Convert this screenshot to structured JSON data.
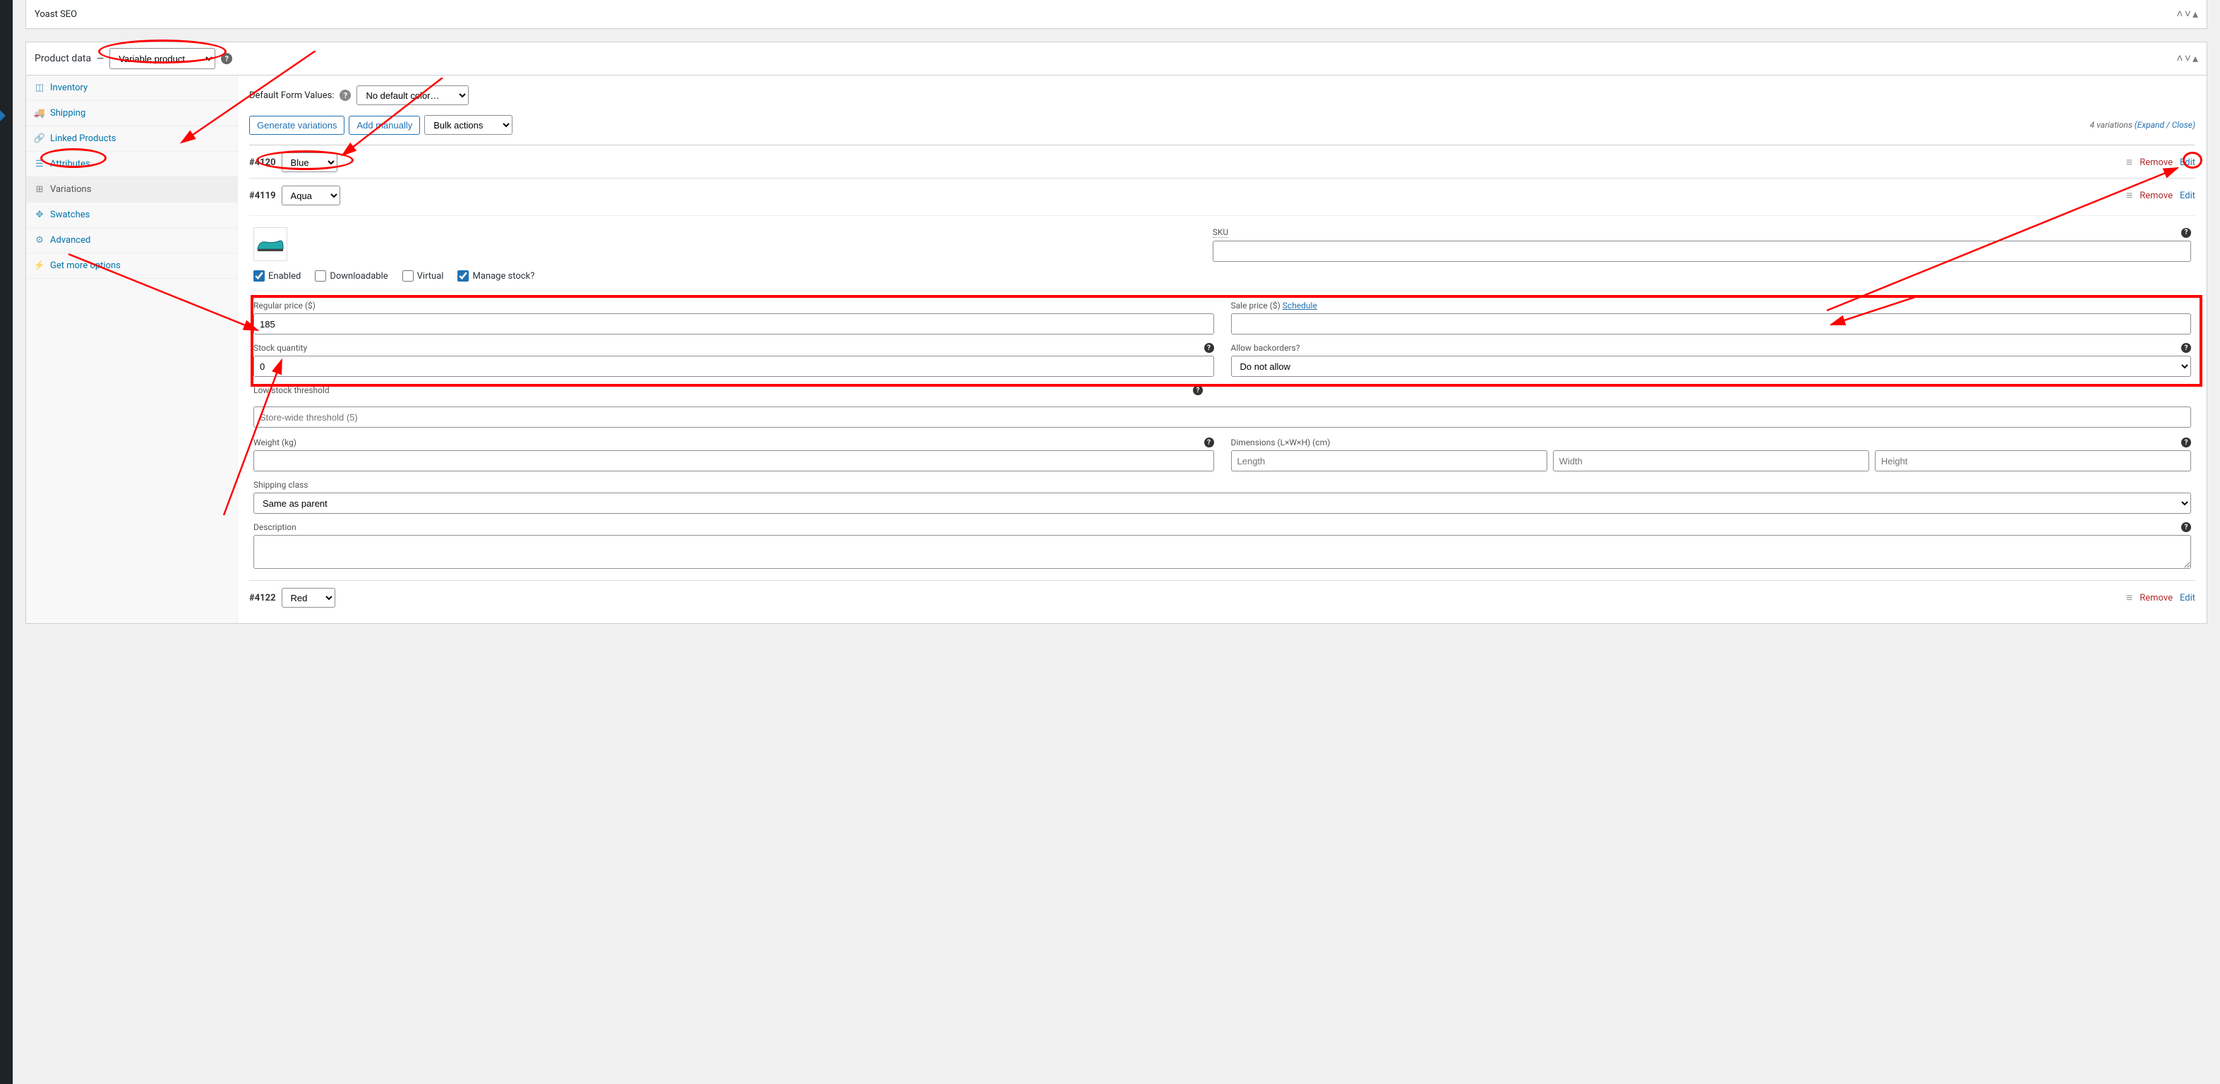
{
  "top_panel": {
    "title": "Yoast SEO"
  },
  "postbox": {
    "title": "Product data",
    "product_type": "Variable product"
  },
  "tabs": [
    {
      "key": "inventory",
      "label": "Inventory",
      "icon": "archive"
    },
    {
      "key": "shipping",
      "label": "Shipping",
      "icon": "truck"
    },
    {
      "key": "linked",
      "label": "Linked Products",
      "icon": "link"
    },
    {
      "key": "attributes",
      "label": "Attributes",
      "icon": "list"
    },
    {
      "key": "variations",
      "label": "Variations",
      "icon": "grid",
      "active": true
    },
    {
      "key": "swatches",
      "label": "Swatches",
      "icon": "arrows"
    },
    {
      "key": "advanced",
      "label": "Advanced",
      "icon": "gear"
    },
    {
      "key": "more",
      "label": "Get more options",
      "icon": "bolt"
    }
  ],
  "defaults": {
    "label": "Default Form Values:",
    "value": "No default color…"
  },
  "buttons": {
    "generate": "Generate variations",
    "add_manual": "Add manually",
    "bulk": "Bulk actions"
  },
  "var_meta": {
    "count": "4 variations",
    "expand": "(Expand / Close)"
  },
  "actions": {
    "remove": "Remove",
    "edit": "Edit"
  },
  "variations": [
    {
      "id": "#4120",
      "color": "Blue"
    },
    {
      "id": "#4119",
      "color": "Aqua",
      "expanded": true
    },
    {
      "id": "#4122",
      "color": "Red"
    }
  ],
  "expanded": {
    "sku_label": "SKU",
    "checkbox_enabled": "Enabled",
    "checkbox_downloadable": "Downloadable",
    "checkbox_virtual": "Virtual",
    "checkbox_manage": "Manage stock?",
    "regular_price_label": "Regular price ($)",
    "regular_price": "185",
    "sale_price_label": "Sale price ($)",
    "schedule": "Schedule",
    "stock_qty_label": "Stock quantity",
    "stock_qty": "0",
    "backorders_label": "Allow backorders?",
    "backorders": "Do not allow",
    "low_stock_label": "Low stock threshold",
    "low_stock_placeholder": "Store-wide threshold (5)",
    "weight_label": "Weight (kg)",
    "dim_label": "Dimensions (L×W×H) (cm)",
    "dim_length": "Length",
    "dim_width": "Width",
    "dim_height": "Height",
    "shipping_class_label": "Shipping class",
    "shipping_class": "Same as parent",
    "description_label": "Description"
  }
}
